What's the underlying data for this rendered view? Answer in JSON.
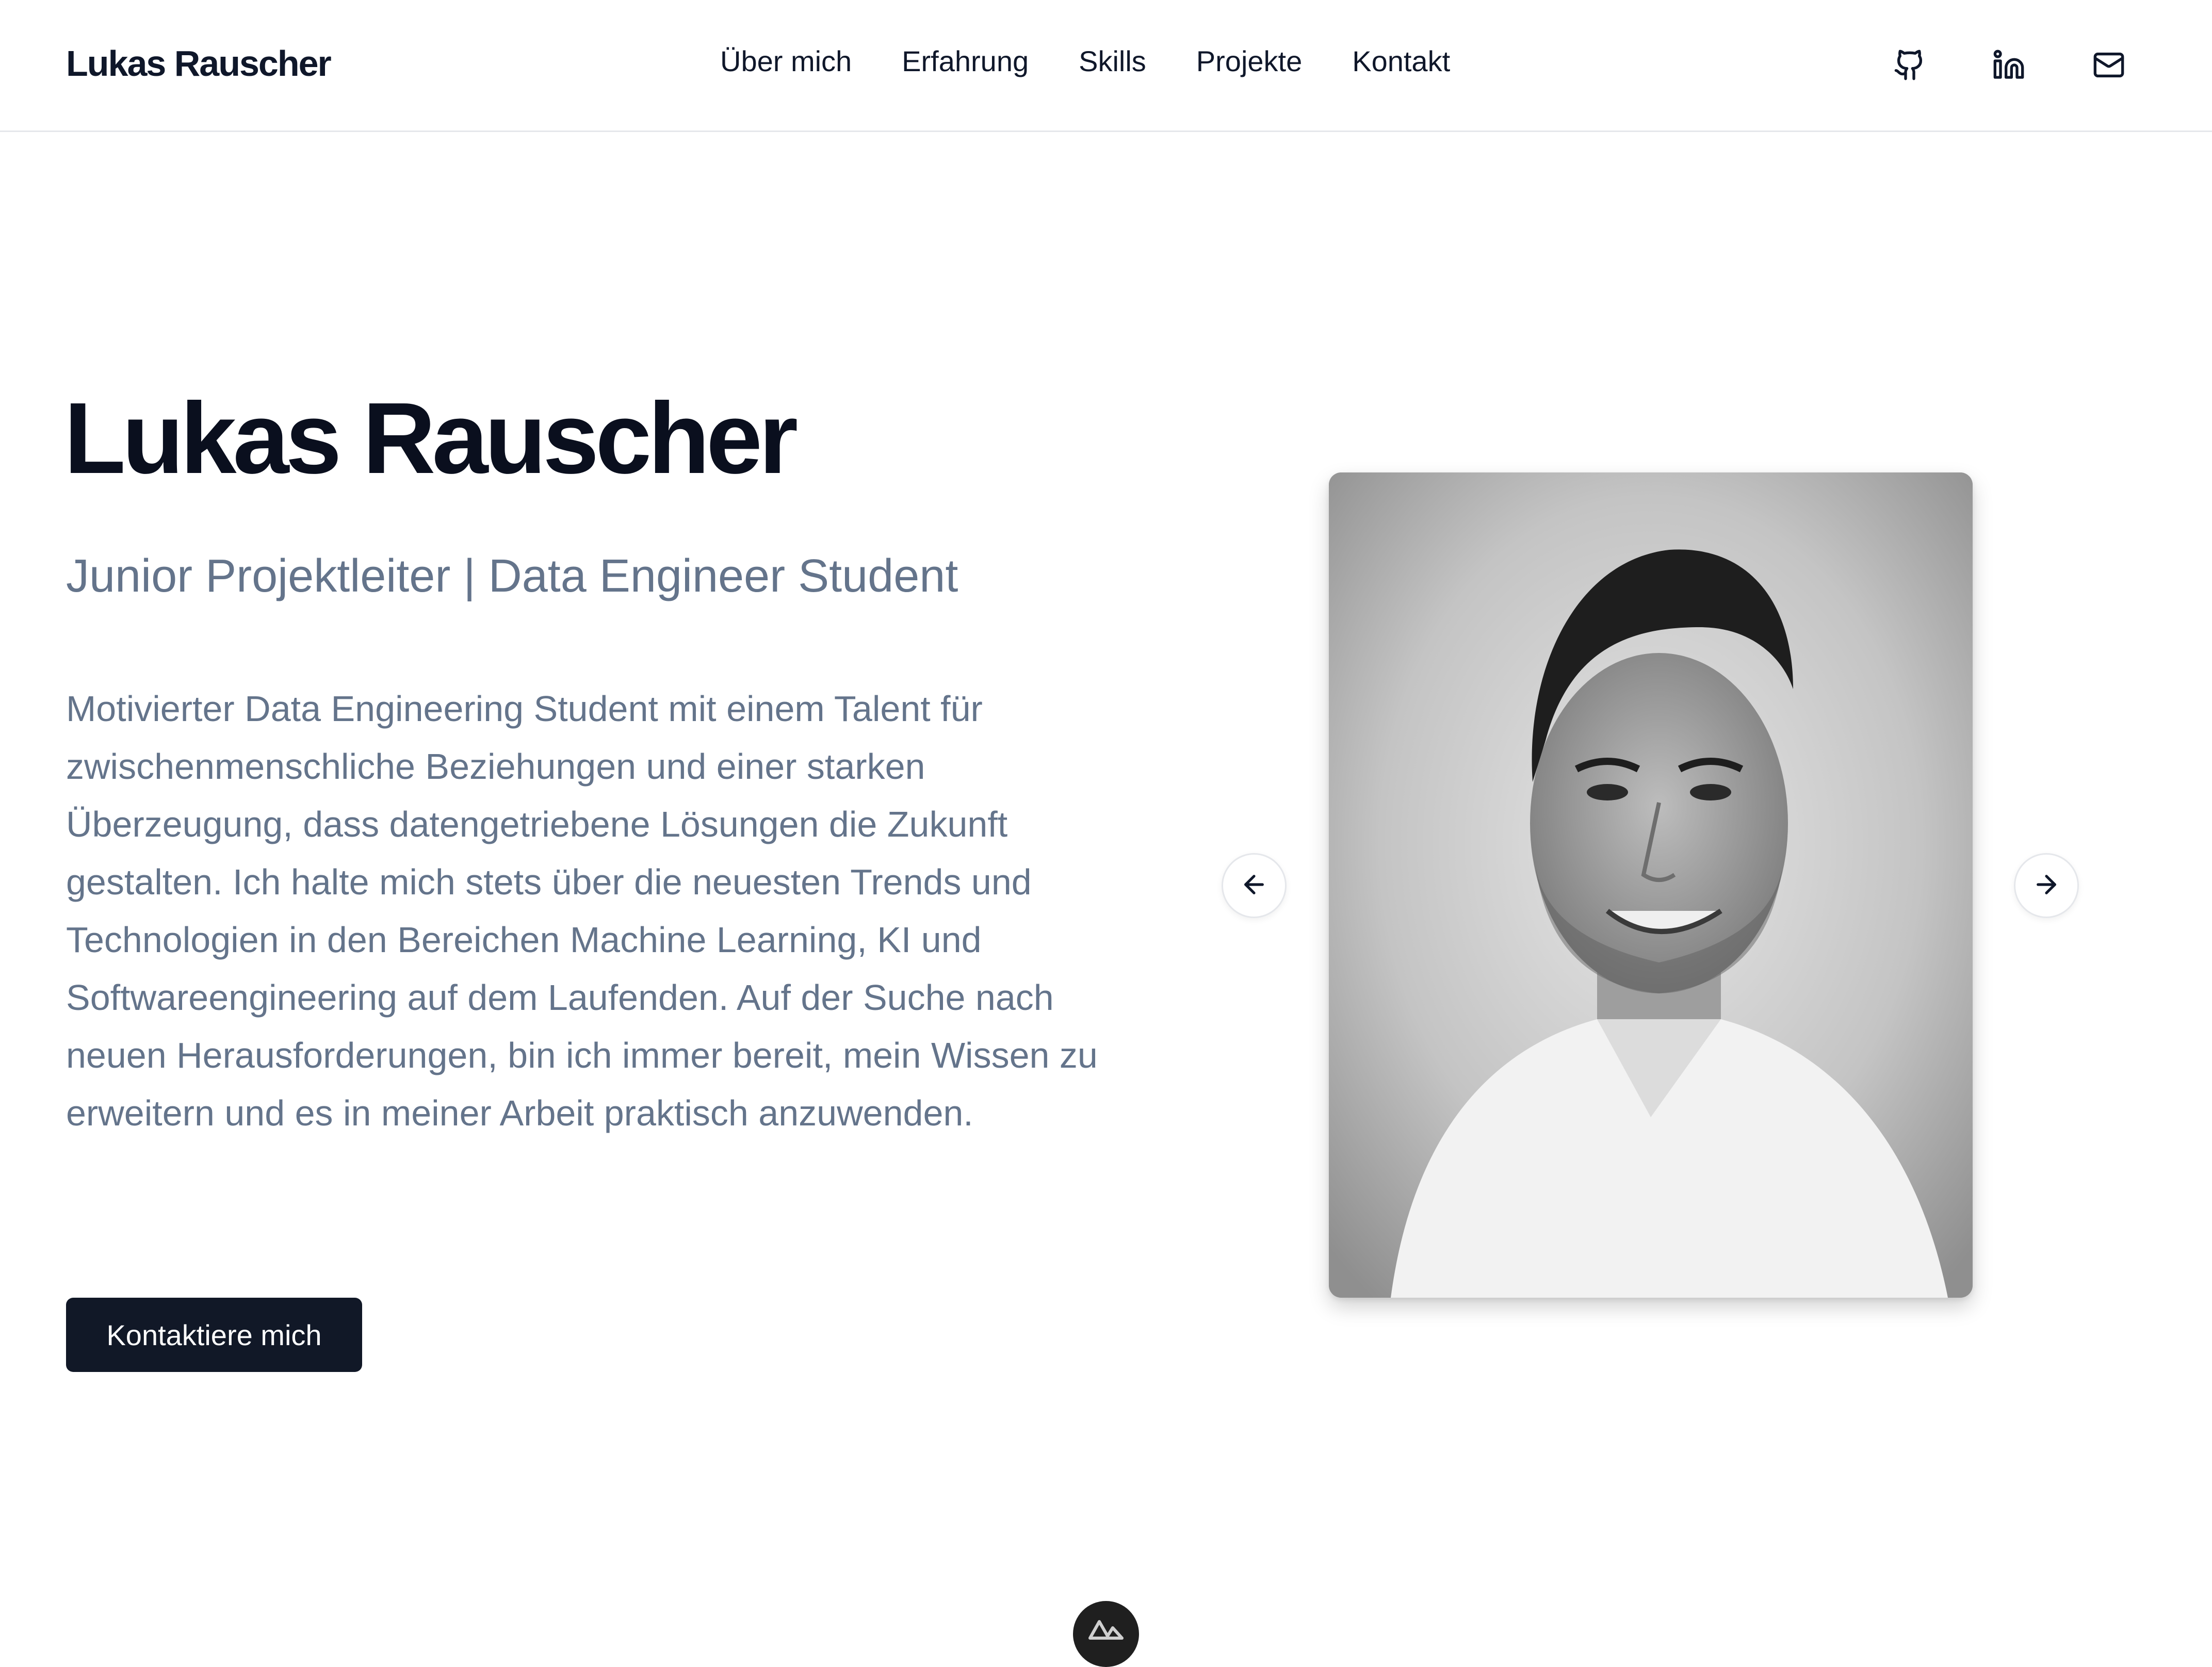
{
  "header": {
    "brand": "Lukas Rauscher",
    "nav": [
      {
        "label": "Über mich"
      },
      {
        "label": "Erfahrung"
      },
      {
        "label": "Skills"
      },
      {
        "label": "Projekte"
      },
      {
        "label": "Kontakt"
      }
    ],
    "social_icons": [
      "github-icon",
      "linkedin-icon",
      "mail-icon"
    ]
  },
  "hero": {
    "title": "Lukas Rauscher",
    "subtitle": "Junior Projektleiter | Data Engineer Student",
    "description": "Motivierter Data Engineering Student mit einem Talent für zwischenmenschliche Beziehungen und einer starken Überzeugung, dass datengetriebene Lösungen die Zukunft gestalten. Ich halte mich stets über die neuesten Trends und Technologien in den Bereichen Machine Learning, KI und Softwareengineering auf dem Laufenden. Auf der Suche nach neuen Herausforderungen, bin ich immer bereit, mein Wissen zu erweitern und es in meiner Arbeit praktisch anzuwenden.",
    "cta_label": "Kontaktiere mich"
  },
  "carousel": {
    "prev_icon": "arrow-left-icon",
    "next_icon": "arrow-right-icon",
    "image": "portrait-photo"
  },
  "footer_badge_icon": "nuxt-logo-icon",
  "colors": {
    "text_primary": "#0f172a",
    "text_muted": "#64748b",
    "button_bg": "#111827",
    "button_text": "#ffffff",
    "border": "#e5e7eb"
  }
}
